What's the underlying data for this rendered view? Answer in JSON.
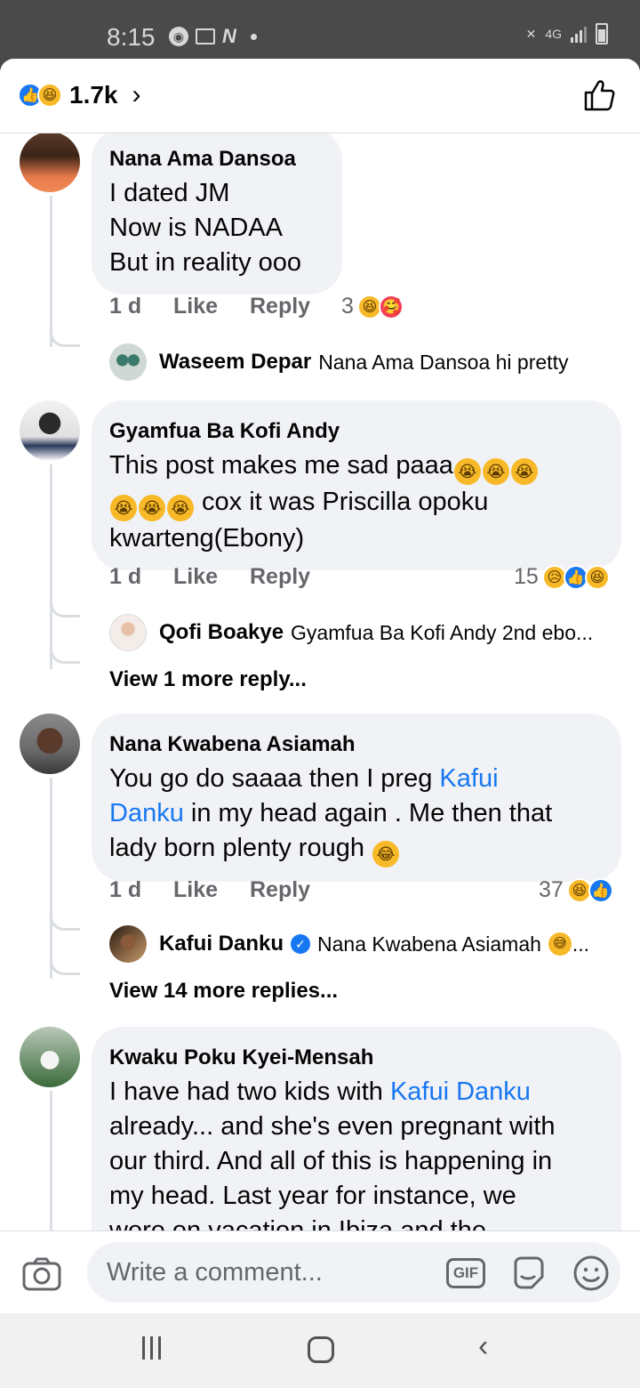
{
  "status_bar": {
    "time": "8:15",
    "network": "4G"
  },
  "header": {
    "reaction_count": "1.7k",
    "reactions": [
      "like",
      "haha"
    ],
    "like_icon": "thumbs-up-outline-icon"
  },
  "comments": [
    {
      "author": "Nana Ama Dansoa",
      "lines": [
        "I dated JM",
        "Now is NADAA",
        "But in reality ooo"
      ],
      "age": "1 d",
      "like_label": "Like",
      "reply_label": "Reply",
      "reaction_count": "3",
      "reactions": [
        "haha",
        "care"
      ],
      "replies": [
        {
          "name": "Waseem Depar",
          "text": "Nana Ama Dansoa hi pretty"
        }
      ]
    },
    {
      "author": "Gyamfua Ba Kofi Andy",
      "text_a": "This post makes me sad paaa",
      "text_b": " cox it was Priscilla opoku",
      "text_c": "kwarteng(Ebony)",
      "age": "1 d",
      "like_label": "Like",
      "reply_label": "Reply",
      "reaction_count": "15",
      "reactions": [
        "sad",
        "like",
        "haha"
      ],
      "replies": [
        {
          "name": "Qofi Boakye",
          "text": "Gyamfua Ba Kofi Andy 2nd ebo..."
        }
      ],
      "view_more": "View 1 more reply..."
    },
    {
      "author": "Nana Kwabena Asiamah",
      "text_a": "You go do saaaa then I preg ",
      "mention_a": "Kafui",
      "mention_b": "Danku",
      "text_b": " in my head again . Me then that",
      "text_c": "lady born plenty rough ",
      "age": "1 d",
      "like_label": "Like",
      "reply_label": "Reply",
      "reaction_count": "37",
      "reactions": [
        "haha",
        "like"
      ],
      "replies": [
        {
          "name": "Kafui Danku",
          "text": "Nana Kwabena Asiamah",
          "suffix": "..."
        }
      ],
      "view_more": "View 14 more replies..."
    },
    {
      "author": "Kwaku Poku Kyei-Mensah",
      "text_a": "I have had two kids with ",
      "mention": "Kafui Danku",
      "line2": "already... and she's even pregnant with",
      "line3": "our third. And all of this is happening in",
      "line4": "my head. Last year for instance, we",
      "line5": "were on vacation in Ibiza and the"
    }
  ],
  "composer": {
    "placeholder": "Write a comment...",
    "gif_label": "GIF"
  },
  "colors": {
    "accent": "#1877f2",
    "bubble": "#f0f2f5",
    "secondary_text": "#65676b"
  }
}
